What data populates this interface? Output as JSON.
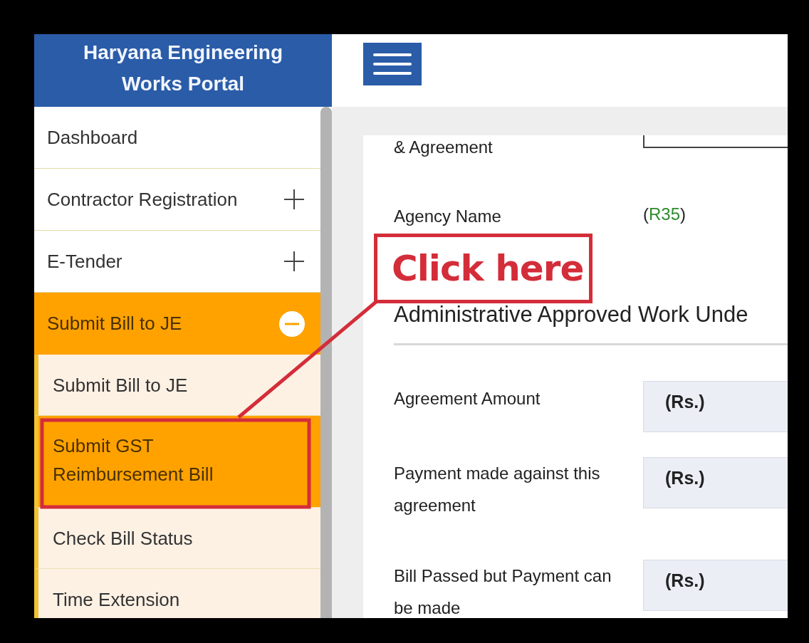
{
  "header": {
    "title": "Haryana Engineering Works Portal"
  },
  "menu": [
    {
      "label": "Dashboard",
      "kind": "link"
    },
    {
      "label": "Contractor Registration",
      "kind": "group",
      "expanded": false
    },
    {
      "label": "E-Tender",
      "kind": "group",
      "expanded": false
    },
    {
      "label": "Submit Bill to JE",
      "kind": "group",
      "expanded": true,
      "children": [
        {
          "label": "Submit Bill to JE",
          "selected": false
        },
        {
          "label": "Submit GST Reimbursement Bill",
          "selected": true
        },
        {
          "label": "Check Bill Status",
          "selected": false
        },
        {
          "label": "Time Extension",
          "selected": false
        }
      ]
    }
  ],
  "form": {
    "rows": [
      {
        "kind": "field",
        "label": "& Agreement"
      },
      {
        "kind": "code",
        "label": "Agency Name",
        "value_parts": [
          {
            "text": "(",
            "highlight": false
          },
          {
            "text": "R35",
            "highlight": true
          },
          {
            "text": ")",
            "highlight": false
          }
        ]
      },
      {
        "kind": "heading",
        "label": "Administrative Approved Work Unde"
      },
      {
        "kind": "amount",
        "label": "Agreement Amount",
        "unit": "(Rs.)"
      },
      {
        "kind": "amount",
        "label": "Payment made against this agreement",
        "unit": "(Rs.)"
      },
      {
        "kind": "amount",
        "label": "Bill Passed but Payment can be made",
        "unit": "(Rs.)"
      }
    ]
  },
  "annotation": {
    "callout": "Click here"
  }
}
